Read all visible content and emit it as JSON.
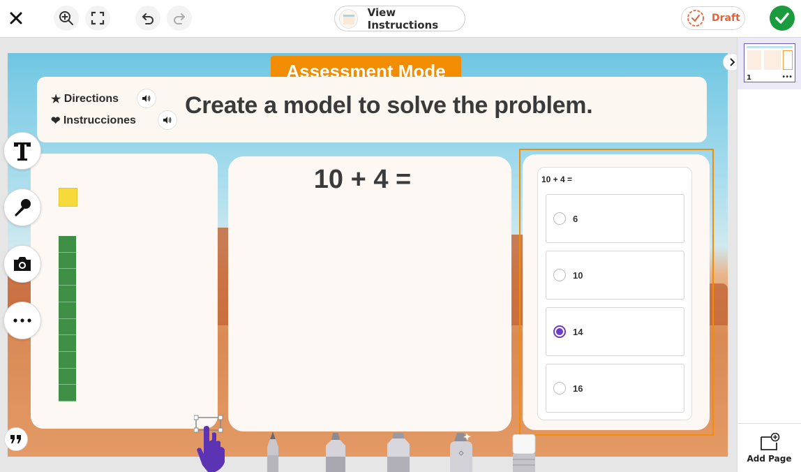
{
  "toolbar": {
    "instructions_label": "View Instructions",
    "draft_label": "Draft"
  },
  "slide": {
    "mode_banner": "Assessment Mode",
    "directions_label": "Directions",
    "instructions_es_label": "Instrucciones",
    "problem_title": "Create a model to solve the problem.",
    "equation": "10 + 4 ="
  },
  "question": {
    "prompt": "10 + 4 =",
    "choices": [
      {
        "label": "6",
        "selected": false
      },
      {
        "label": "10",
        "selected": false
      },
      {
        "label": "14",
        "selected": true
      },
      {
        "label": "16",
        "selected": false
      }
    ]
  },
  "pages": {
    "current_number": "1",
    "add_page_label": "Add Page"
  },
  "colors": {
    "accent_orange": "#f28c00",
    "submit_green": "#1a9c3e",
    "radio_purple": "#6a3cc9",
    "draft_orange": "#e0643a"
  },
  "icons": [
    "close-icon",
    "zoom-in-icon",
    "fullscreen-icon",
    "undo-icon",
    "redo-icon",
    "draft-icon",
    "checkmark-icon",
    "speaker-icon",
    "text-tool-icon",
    "microphone-icon",
    "camera-icon",
    "more-icon",
    "quote-icon",
    "chevron-right-icon",
    "add-page-icon",
    "pointer-hand-icon",
    "pencil-icon",
    "marker-icon",
    "highlighter-icon",
    "glitter-pen-icon",
    "eraser-icon"
  ]
}
